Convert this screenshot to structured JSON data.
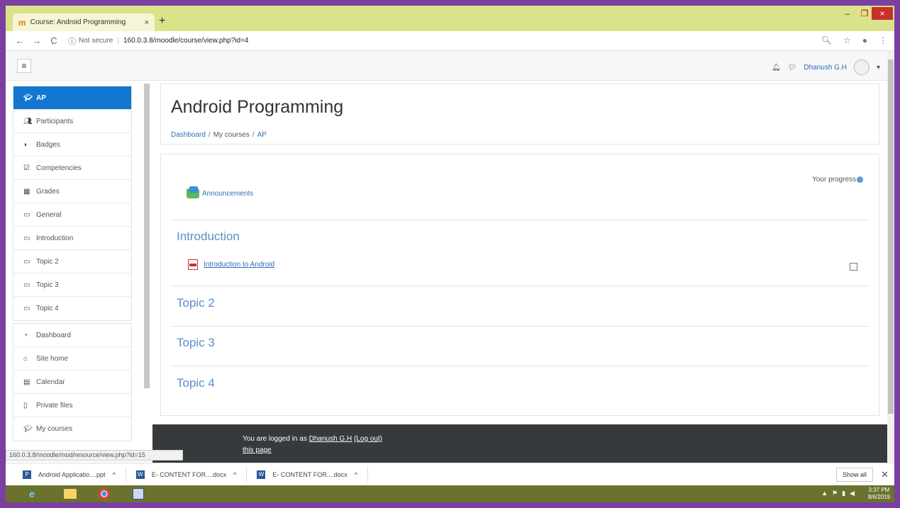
{
  "browser": {
    "tab_title": "Course: Android Programming",
    "tab_close": "×",
    "new_tab": "+",
    "security": "Not secure",
    "url": "160.0.3.8/moodle/course/view.php?id=4"
  },
  "navbar": {
    "user_name": "Dhanush G.H"
  },
  "drawer": {
    "course": [
      {
        "label": "AP",
        "icon": "graduation-cap-icon"
      },
      {
        "label": "Participants",
        "icon": "users-icon"
      },
      {
        "label": "Badges",
        "icon": "shield-icon"
      },
      {
        "label": "Competencies",
        "icon": "checkbox-icon"
      },
      {
        "label": "Grades",
        "icon": "table-icon"
      }
    ],
    "sections": [
      {
        "label": "General"
      },
      {
        "label": "Introduction"
      },
      {
        "label": "Topic 2"
      },
      {
        "label": "Topic 3"
      },
      {
        "label": "Topic 4"
      }
    ],
    "site": [
      {
        "label": "Dashboard",
        "icon": "dashboard-icon"
      },
      {
        "label": "Site home",
        "icon": "home-icon"
      },
      {
        "label": "Calendar",
        "icon": "calendar-icon"
      },
      {
        "label": "Private files",
        "icon": "file-icon"
      },
      {
        "label": "My courses",
        "icon": "graduation-cap-icon"
      }
    ]
  },
  "header": {
    "title": "Android Programming",
    "breadcrumb": [
      "Dashboard",
      "My courses",
      "AP"
    ]
  },
  "content": {
    "progress_label": "Your progress",
    "announcements": "Announcements",
    "sections": [
      {
        "title": "Introduction"
      },
      {
        "title": "Topic 2"
      },
      {
        "title": "Topic 3"
      },
      {
        "title": "Topic 4"
      }
    ],
    "activity": "Introduction to Android"
  },
  "footer": {
    "logged_in_prefix": "You are logged in as",
    "user": "Dhanush G.H",
    "logout": "(Log out)",
    "line2": "this page"
  },
  "status_url": "160.0.3.8/moodle/mod/resource/view.php?id=15",
  "downloads": {
    "items": [
      "Android Applicatio....ppt",
      "E- CONTENT FOR....docx",
      "E- CONTENT FOR....docx"
    ],
    "show_all": "Show all"
  },
  "taskbar": {
    "time": "3:37 PM",
    "date": "8/6/2019"
  },
  "colors": {
    "accent": "#1177d1",
    "link": "#2a6fb5",
    "footer_bg": "#373a3c"
  }
}
